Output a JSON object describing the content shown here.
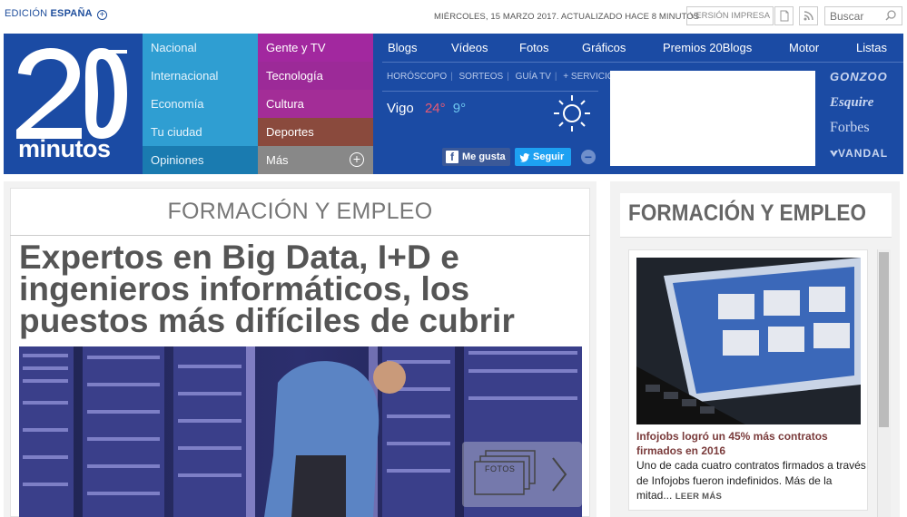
{
  "topbar": {
    "edition_prefix": "EDICIÓN",
    "edition_name": "ESPAÑA",
    "date": "MIÉRCOLES, 15 MARZO 2017. ACTUALIZADO HACE 8 MINUTOS",
    "print_label": "VERSIÓN IMPRESA",
    "search_placeholder": "Buscar"
  },
  "logo": {
    "number": "20",
    "word": "minutos"
  },
  "nav_blue": [
    {
      "label": "Nacional"
    },
    {
      "label": "Internacional"
    },
    {
      "label": "Economía"
    },
    {
      "label": "Tu ciudad"
    },
    {
      "label": "Opiniones"
    }
  ],
  "nav_purple": [
    {
      "label": "Gente y TV"
    },
    {
      "label": "Tecnología"
    },
    {
      "label": "Cultura"
    },
    {
      "label": "Deportes"
    },
    {
      "label": "Más"
    }
  ],
  "mainnav": [
    {
      "label": "Blogs"
    },
    {
      "label": "Vídeos"
    },
    {
      "label": "Fotos"
    },
    {
      "label": "Gráficos"
    },
    {
      "label": "Premios 20Blogs"
    },
    {
      "label": "Motor"
    },
    {
      "label": "Listas"
    }
  ],
  "subnav": [
    {
      "label": "HORÓSCOPO"
    },
    {
      "label": "SORTEOS"
    },
    {
      "label": "GUÍA TV"
    },
    {
      "label": "+ SERVICIOS"
    }
  ],
  "weather": {
    "city": "Vigo",
    "max": "24°",
    "min": "9°"
  },
  "social": {
    "facebook": "Me gusta",
    "twitter": "Seguir"
  },
  "brands": [
    "GONZOO",
    "Esquire",
    "Forbes",
    "VANDAL"
  ],
  "main": {
    "section": "FORMACIÓN Y EMPLEO",
    "headline": "Expertos en Big Data, I+D e ingenieros informáticos, los puestos más difíciles de cubrir",
    "photos_label": "FOTOS"
  },
  "sidebar": {
    "section": "FORMACIÓN Y EMPLEO",
    "headline": "Infojobs logró un 45% más contratos firmados en 2016",
    "summary": "Uno de cada cuatro contratos firmados a través de Infojobs fueron indefinidos. Más de la mitad...",
    "read_more": "LEER MÁS"
  },
  "colors": {
    "header_blue": "#1b4ba4",
    "nav_blue": "#2f9ed2",
    "nav_purple": "#a2289f",
    "nav_brown": "#8a4a3d",
    "temp_max": "#e85a73",
    "temp_min": "#6ec7f0"
  }
}
